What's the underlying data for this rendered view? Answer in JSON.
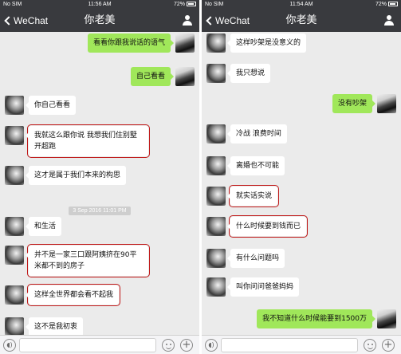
{
  "left": {
    "status": {
      "carrier": "No SIM",
      "time": "11:56 AM",
      "battery": "72%"
    },
    "nav": {
      "back": "WeChat",
      "title": "你老美"
    },
    "messages": [
      {
        "side": "me",
        "text": "看看你跟我说话的语气"
      },
      {
        "side": "me",
        "text": "自己看看"
      },
      {
        "side": "them",
        "text": "你自己看看"
      },
      {
        "side": "them",
        "text": "我就这么跟你说 我想我们住别墅 开超跑",
        "highlighted": true
      },
      {
        "side": "them",
        "text": "这才是属于我们本来的构思"
      },
      {
        "side": "them",
        "text": "和生活"
      },
      {
        "side": "them",
        "text": "并不是一家三口跟阿姨挤在90平米都不到的房子",
        "highlighted": true
      },
      {
        "side": "them",
        "text": "这样全世界都会看不起我",
        "highlighted": true
      },
      {
        "side": "them",
        "text": "这不是我初衷"
      }
    ],
    "timestamp": "3 Sep 2016 11:01 PM"
  },
  "right": {
    "status": {
      "carrier": "No SIM",
      "time": "11:54 AM",
      "battery": "72%"
    },
    "nav": {
      "back": "WeChat",
      "title": "你老美"
    },
    "messages": [
      {
        "side": "them",
        "text": "这样吵架是没意义的"
      },
      {
        "side": "them",
        "text": "我只想说"
      },
      {
        "side": "me",
        "text": "没有吵架"
      },
      {
        "side": "them",
        "text": "冷战 浪费时间"
      },
      {
        "side": "them",
        "text": "离婚也不可能"
      },
      {
        "side": "them",
        "text": "就实话实说",
        "highlighted": true
      },
      {
        "side": "them",
        "text": "什么时候要到钱而已",
        "highlighted": true
      },
      {
        "side": "them",
        "text": "有什么问题吗"
      },
      {
        "side": "them",
        "text": "叫你问问爸爸妈妈"
      },
      {
        "side": "me",
        "text": "我不知道什么时候能要到1500万"
      }
    ]
  },
  "icons": {
    "back": "chevron-left-icon",
    "contact": "person-icon",
    "voice": "voice-icon",
    "emoji": "emoji-icon",
    "more": "plus-icon"
  },
  "colors": {
    "navbar": "#393a3e",
    "chat_bg": "#ebebeb",
    "my_bubble": "#a0e75a",
    "their_bubble": "#ffffff",
    "highlight_box": "#c01818"
  }
}
